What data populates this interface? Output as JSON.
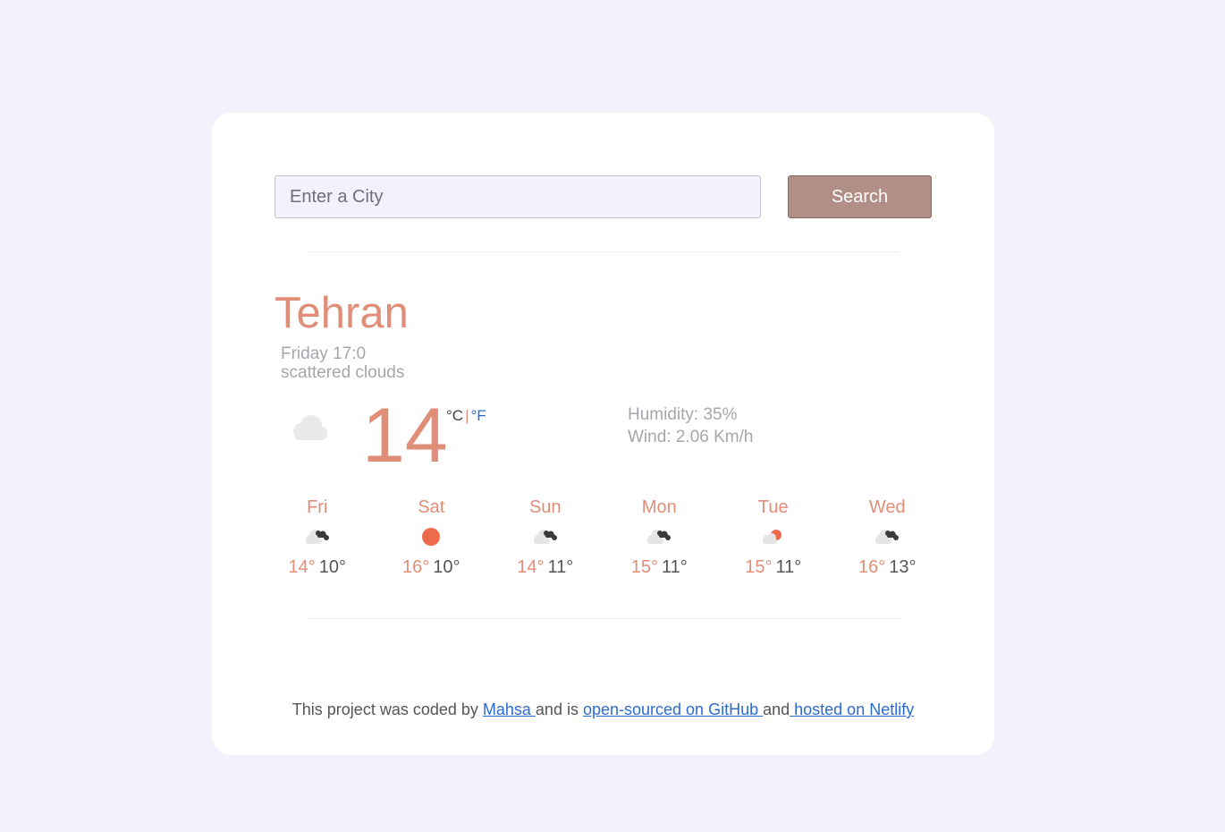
{
  "search": {
    "placeholder": "Enter a City",
    "button_label": "Search"
  },
  "current": {
    "city": "Tehran",
    "datetime": "Friday 17:0",
    "description": "scattered clouds",
    "icon": "cloud-icon",
    "temperature": "14",
    "unit_c": "°C",
    "unit_sep": "|",
    "unit_f": "°F",
    "humidity": "Humidity: 35%",
    "wind": "Wind: 2.06 Km/h"
  },
  "forecast": [
    {
      "day": "Fri",
      "icon": "broken-clouds-icon",
      "max": "14°",
      "min": "10°"
    },
    {
      "day": "Sat",
      "icon": "sun-icon",
      "max": "16°",
      "min": "10°"
    },
    {
      "day": "Sun",
      "icon": "broken-clouds-icon",
      "max": "14°",
      "min": "11°"
    },
    {
      "day": "Mon",
      "icon": "broken-clouds-icon",
      "max": "15°",
      "min": "11°"
    },
    {
      "day": "Tue",
      "icon": "partly-cloudy-icon",
      "max": "15°",
      "min": "11°"
    },
    {
      "day": "Wed",
      "icon": "broken-clouds-icon",
      "max": "16°",
      "min": "13°"
    }
  ],
  "footer": {
    "text1": "This project was coded by ",
    "author": "Mahsa ",
    "text2": "and is ",
    "github": "open-sourced on GitHub ",
    "text3": "and",
    "netlify": " hosted on Netlify"
  },
  "colors": {
    "accent": "#e08e78",
    "button": "#b18f86",
    "link": "#2b6ad3",
    "background": "#f3f1fb"
  }
}
